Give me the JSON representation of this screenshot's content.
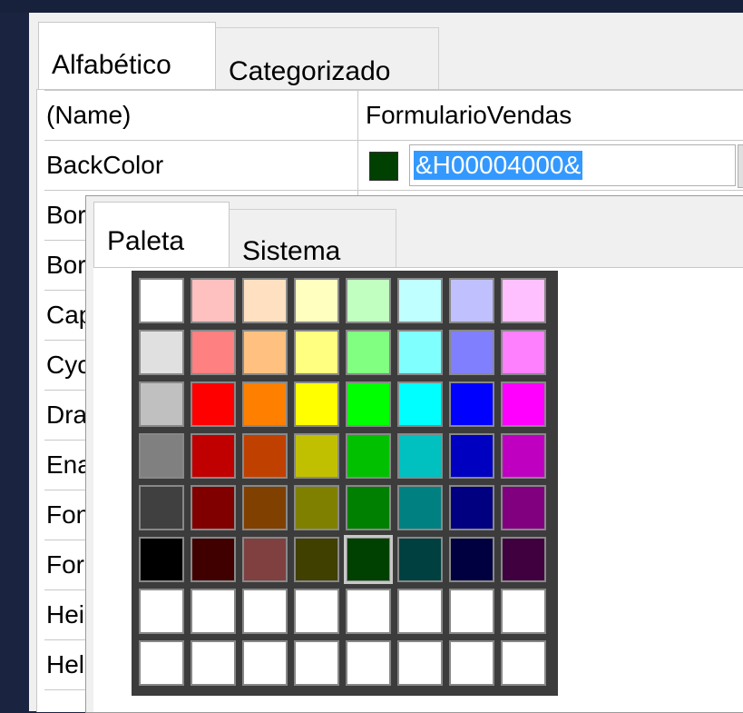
{
  "tabs": [
    {
      "label": "Alfabético"
    },
    {
      "label": "Categorizado"
    }
  ],
  "properties": [
    {
      "name": "(Name)",
      "value": "FormularioVendas"
    },
    {
      "name": "BackColor",
      "value": "&H00004000&"
    },
    {
      "name": "Bord",
      "value": ""
    },
    {
      "name": "Bord",
      "value": ""
    },
    {
      "name": "Capt",
      "value": ""
    },
    {
      "name": "Cycle",
      "value": ""
    },
    {
      "name": "Draw",
      "value": ""
    },
    {
      "name": "Enab",
      "value": ""
    },
    {
      "name": "Font",
      "value": ""
    },
    {
      "name": "Fore",
      "value": ""
    },
    {
      "name": "Heigl",
      "value": ""
    },
    {
      "name": "Help",
      "value": ""
    }
  ],
  "backcolor_swatch": "#004000",
  "picker": {
    "tabs": [
      {
        "label": "Paleta"
      },
      {
        "label": "Sistema"
      }
    ],
    "selected": "#004000",
    "palette": [
      [
        "#ffffff",
        "#ffc0c0",
        "#ffe0c0",
        "#ffffc0",
        "#c0ffc0",
        "#c0ffff",
        "#c0c0ff",
        "#ffc0ff"
      ],
      [
        "#e0e0e0",
        "#ff8080",
        "#ffc080",
        "#ffff80",
        "#80ff80",
        "#80ffff",
        "#8080ff",
        "#ff80ff"
      ],
      [
        "#c0c0c0",
        "#ff0000",
        "#ff8000",
        "#ffff00",
        "#00ff00",
        "#00ffff",
        "#0000ff",
        "#ff00ff"
      ],
      [
        "#808080",
        "#c00000",
        "#c04000",
        "#c0c000",
        "#00c000",
        "#00c0c0",
        "#0000c0",
        "#c000c0"
      ],
      [
        "#404040",
        "#800000",
        "#804000",
        "#808000",
        "#008000",
        "#008080",
        "#000080",
        "#800080"
      ],
      [
        "#000000",
        "#400000",
        "#804040",
        "#404000",
        "#004000",
        "#004040",
        "#000040",
        "#400040"
      ],
      [
        "#ffffff",
        "#ffffff",
        "#ffffff",
        "#ffffff",
        "#ffffff",
        "#ffffff",
        "#ffffff",
        "#ffffff"
      ],
      [
        "#ffffff",
        "#ffffff",
        "#ffffff",
        "#ffffff",
        "#ffffff",
        "#ffffff",
        "#ffffff",
        "#ffffff"
      ]
    ]
  }
}
